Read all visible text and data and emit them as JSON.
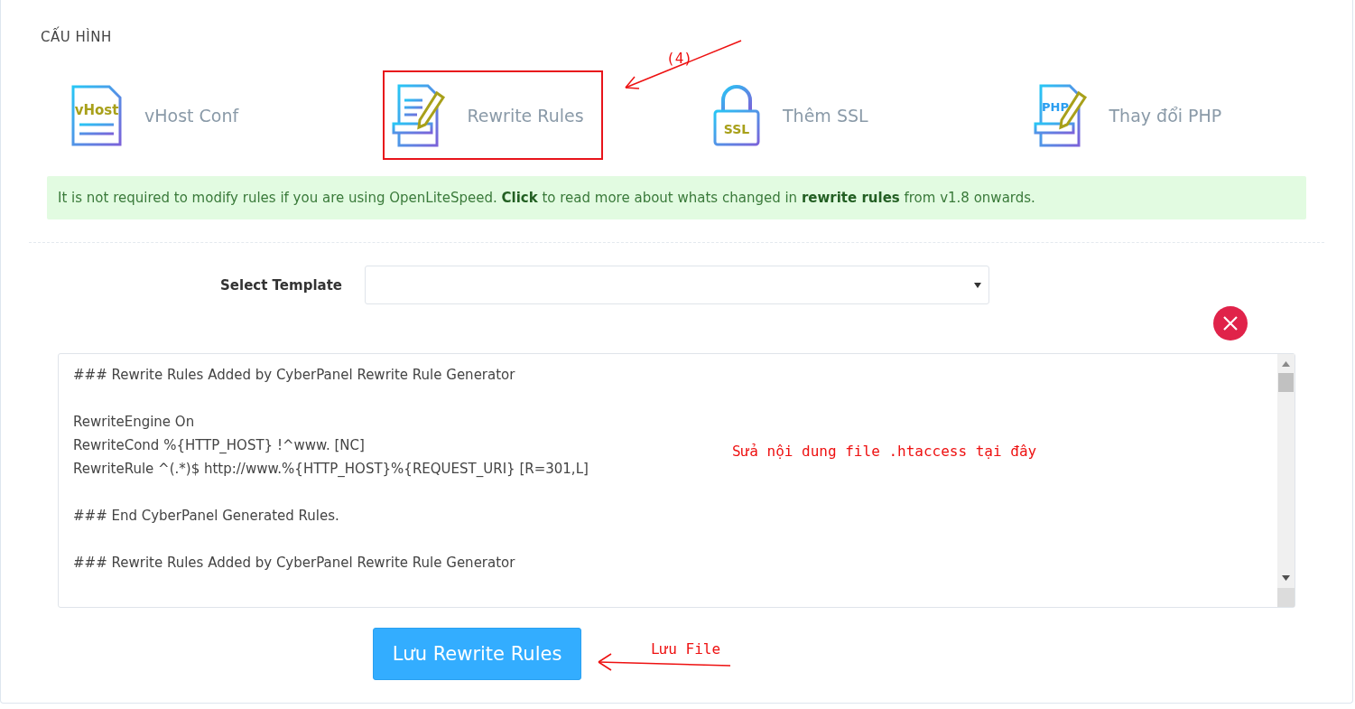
{
  "section_title": "CẤU HÌNH",
  "tiles": [
    {
      "kind": "vhost",
      "icon_text": "vHost",
      "label": "vHost Conf",
      "highlighted": false
    },
    {
      "kind": "rewrite",
      "label": "Rewrite Rules",
      "highlighted": true
    },
    {
      "kind": "ssl",
      "icon_text": "SSL",
      "label": "Thêm SSL",
      "highlighted": false
    },
    {
      "kind": "php",
      "icon_text": "PHP",
      "label": "Thay đổi PHP",
      "highlighted": false
    }
  ],
  "alert": "It is not required to modify rules if you are using OpenLiteSpeed. **Click** to read more about whats changed in **rewrite rules** from v1.8 onwards.",
  "template": {
    "label": "Select Template"
  },
  "editor": {
    "blocks": [
      [
        "### Rewrite Rules Added by CyberPanel Rewrite Rule Generator"
      ],
      [
        "RewriteEngine On",
        "RewriteCond %{HTTP_HOST} !^www. [NC]",
        "RewriteRule ^(.*)$ http://www.%{HTTP_HOST}%{REQUEST_URI} [R=301,L]"
      ],
      [
        "### End CyberPanel Generated Rules."
      ],
      [
        "### Rewrite Rules Added by CyberPanel Rewrite Rule Generator"
      ]
    ]
  },
  "save_button": "Lưu Rewrite Rules",
  "annotations": [
    {
      "kind": "step",
      "text": "(4)"
    },
    {
      "kind": "note",
      "text": "Sửa nội dung file .htaccess tại đây"
    },
    {
      "kind": "save",
      "text": "Lưu File"
    }
  ]
}
